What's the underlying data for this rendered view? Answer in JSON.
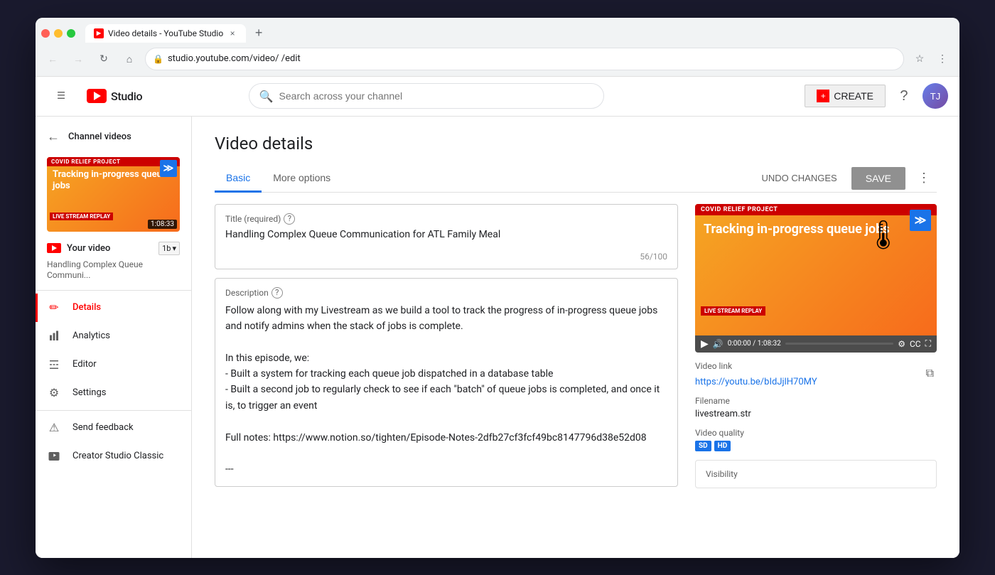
{
  "browser": {
    "tab_title": "Video details - YouTube Studio",
    "url": "studio.youtube.com/video/           /edit",
    "favicon": "▶"
  },
  "navbar": {
    "logo_text": "Studio",
    "search_placeholder": "Search across your channel",
    "create_label": "CREATE",
    "help_icon": "?",
    "hamburger_icon": "☰"
  },
  "sidebar": {
    "back_label": "Channel videos",
    "thumbnail": {
      "banner": "COVID RELIEF PROJECT",
      "title": "Tracking in-progress queue jobs",
      "duration": "1:08:33",
      "live_label": "LIVE STREAM REPLAY"
    },
    "your_video": "Your video",
    "video_title_short": "Handling Complex Queue Communi...",
    "nav_items": [
      {
        "id": "details",
        "label": "Details",
        "icon": "✏️",
        "active": true
      },
      {
        "id": "analytics",
        "label": "Analytics",
        "icon": "📊",
        "active": false
      },
      {
        "id": "editor",
        "label": "Editor",
        "icon": "🎬",
        "active": false
      },
      {
        "id": "settings",
        "label": "Settings",
        "icon": "⚙️",
        "active": false
      },
      {
        "id": "feedback",
        "label": "Send feedback",
        "icon": "💬",
        "active": false
      },
      {
        "id": "classic",
        "label": "Creator Studio Classic",
        "icon": "🔗",
        "active": false
      }
    ]
  },
  "page": {
    "title": "Video details",
    "tabs": [
      {
        "id": "basic",
        "label": "Basic",
        "active": true
      },
      {
        "id": "more",
        "label": "More options",
        "active": false
      }
    ],
    "undo_label": "UNDO CHANGES",
    "save_label": "SAVE"
  },
  "form": {
    "title_label": "Title (required)",
    "title_value": "Handling Complex Queue Communication for ATL Family Meal",
    "title_counter": "56/100",
    "description_label": "Description",
    "description_value": "Follow along with my Livestream as we build a tool to track the progress of in-progress queue jobs and notify admins when the stack of jobs is complete.\n\nIn this episode, we:\n- Built a system for tracking each queue job dispatched in a database table\n- Built a second job to regularly check to see if each \"batch\" of queue jobs is completed, and once it is, to trigger an event\n\nFull notes: https://www.notion.so/tighten/Episode-Notes-2dfb27cf3fcf49bc8147796d38e52d08\n\n---"
  },
  "video_panel": {
    "banner": "COVID RELIEF PROJECT",
    "thumb_title": "Tracking in-progress queue jobs",
    "live_label": "LIVE STREAM REPLAY",
    "time_current": "0:00:00",
    "time_total": "1:08:32",
    "video_link_label": "Video link",
    "video_url": "https://youtu.be/bIdJjlH70MY",
    "filename_label": "Filename",
    "filename_value": "livestream.str",
    "quality_label": "Video quality",
    "quality_badges": [
      "SD",
      "HD"
    ],
    "visibility_label": "Visibility"
  }
}
